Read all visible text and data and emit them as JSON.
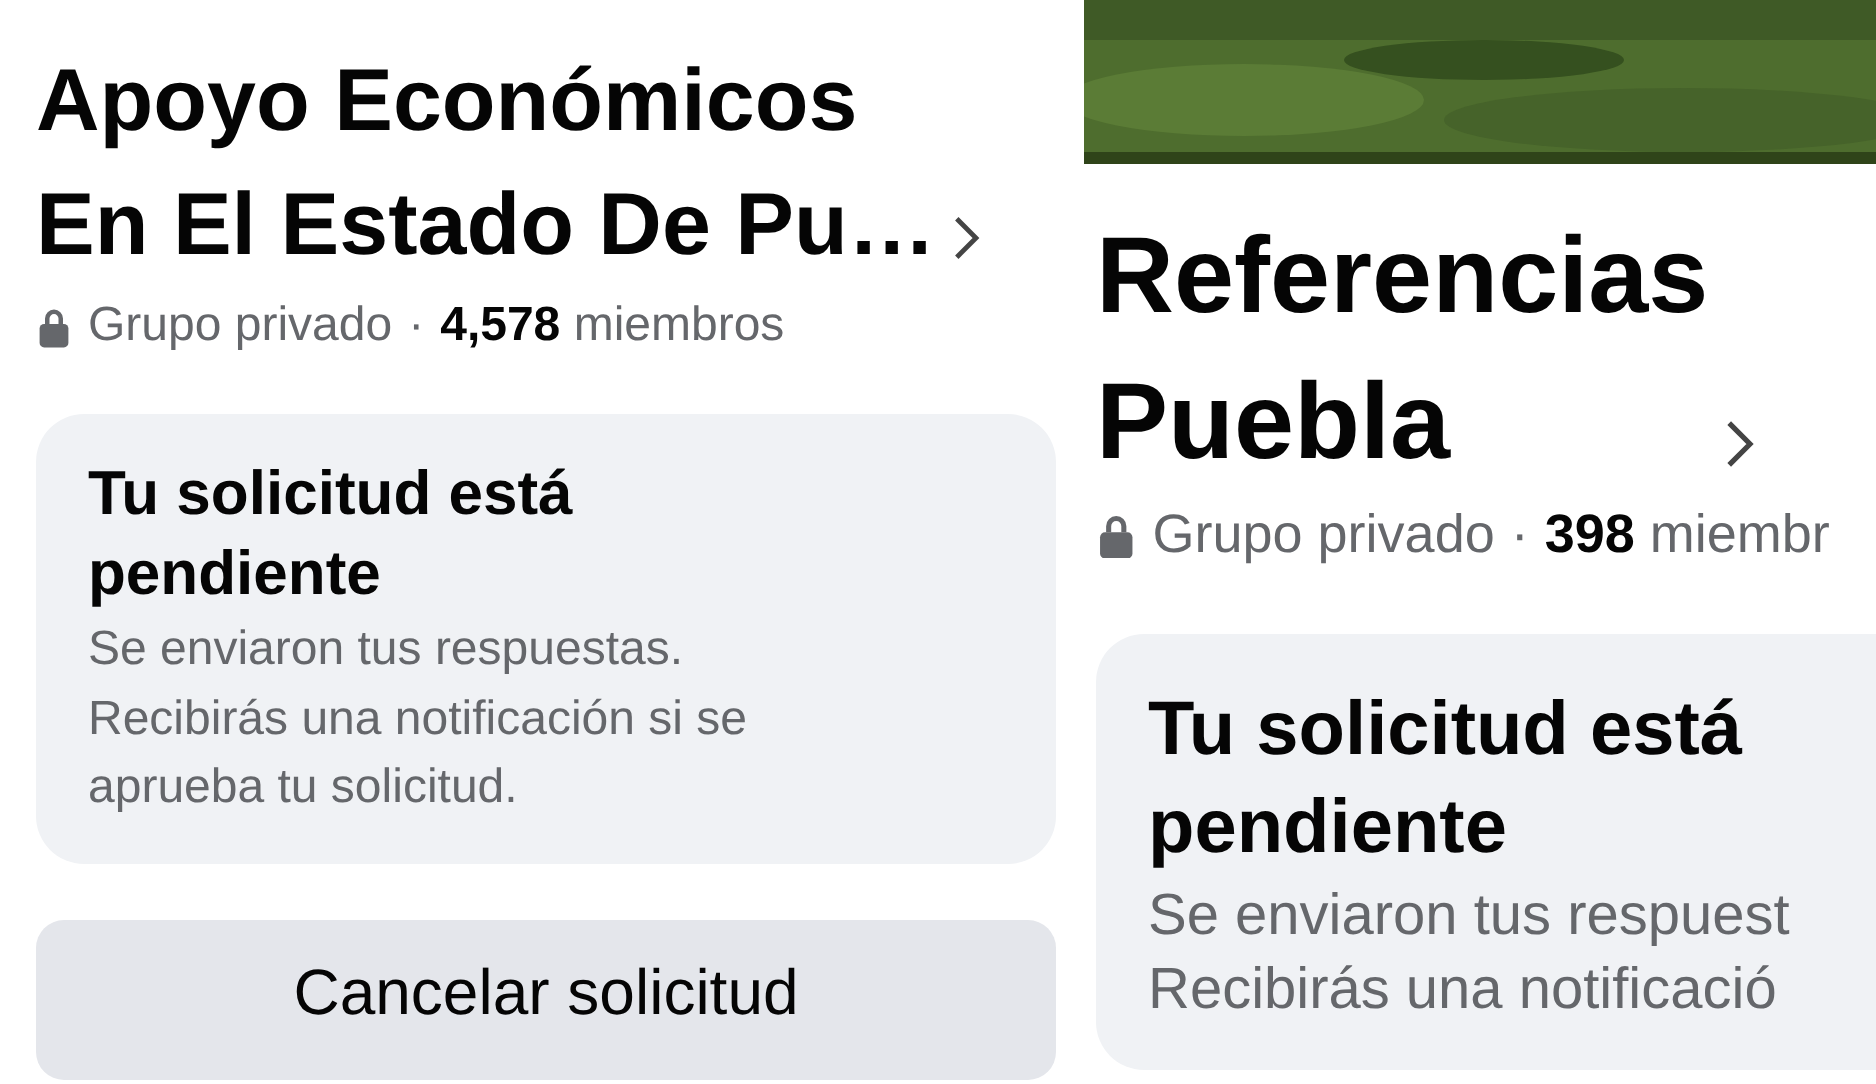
{
  "left": {
    "title_lines": [
      "Apoyo Económicos",
      "En El Estado De Pu…"
    ],
    "meta": {
      "privacy": "Grupo privado",
      "separator": "·",
      "members": "**4,578** miembros"
    },
    "card": {
      "title_lines": [
        "Tu solicitud está",
        "pendiente"
      ],
      "body_lines": [
        "Se enviaron tus respuestas.",
        "Recibirás una notificación si se",
        "aprueba tu solicitud."
      ]
    },
    "button": "Cancelar solicitud"
  },
  "right": {
    "header": {
      "kind": "picture"
    },
    "title_lines": [
      "Referencias",
      "Puebla"
    ],
    "meta": {
      "privacy": "Grupo privado",
      "separator": "·",
      "members": "**398** miembr"
    },
    "card": {
      "title_lines": [
        "Tu solicitud está",
        "pendiente"
      ],
      "body_lines": [
        "Se enviaron tus respuest",
        "Recibirás una notificació"
      ]
    }
  }
}
